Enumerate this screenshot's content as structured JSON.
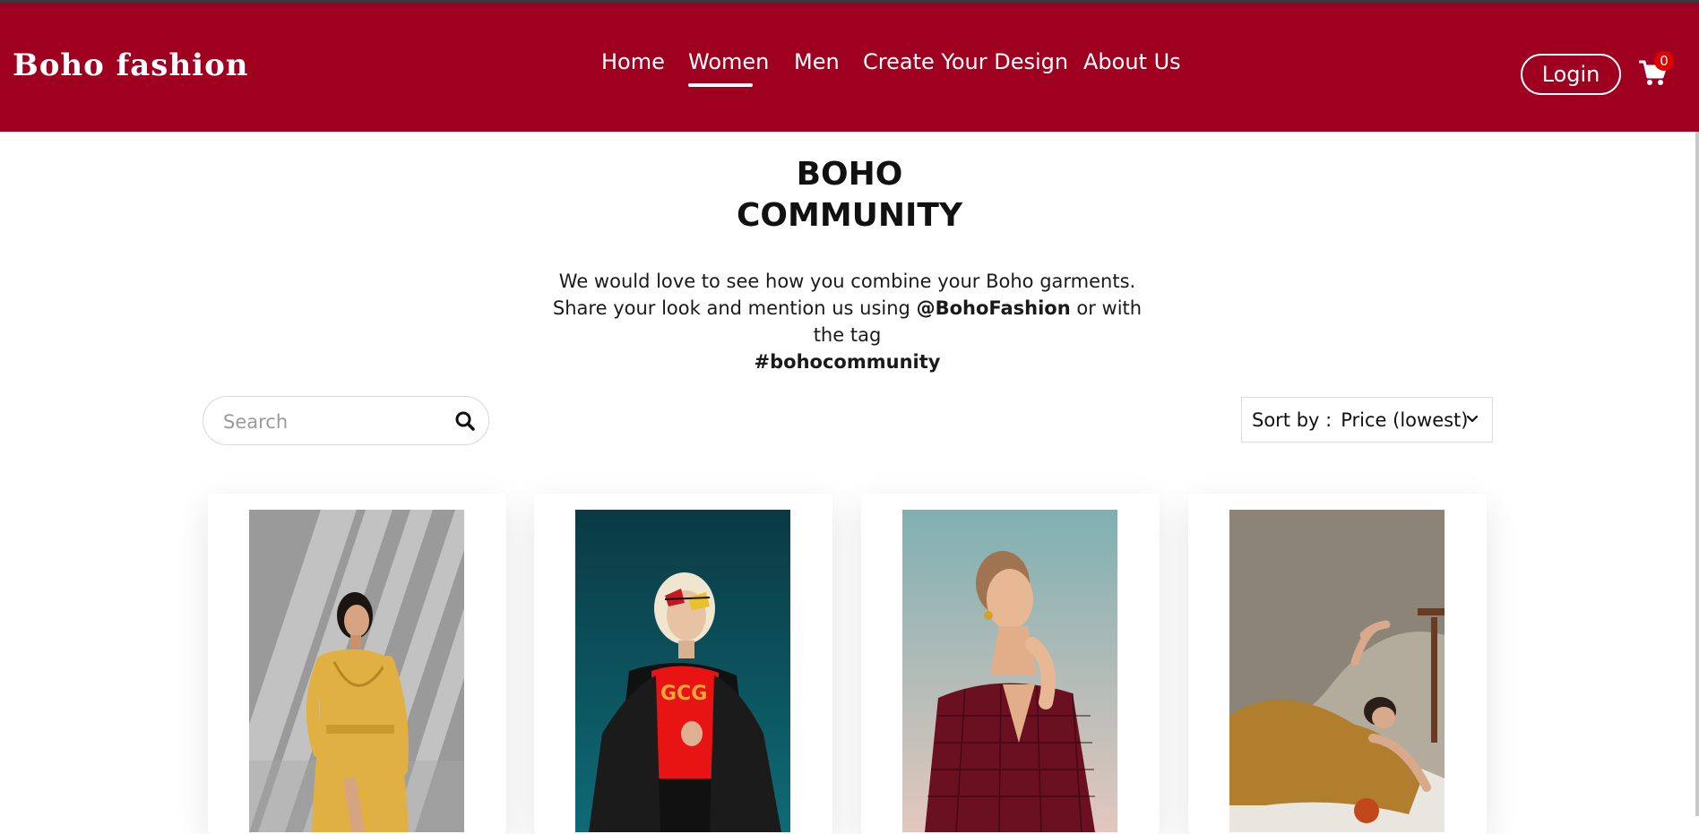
{
  "brand": {
    "logo_text": "Boho fashion",
    "accent_color": "#a00020"
  },
  "nav": {
    "items": [
      {
        "label": "Home",
        "active": false
      },
      {
        "label": "Women",
        "active": true
      },
      {
        "label": "Men",
        "active": false
      },
      {
        "label": "Create Your Design",
        "active": false
      },
      {
        "label": "About Us",
        "active": false
      }
    ],
    "login_label": "Login",
    "cart_count": "0"
  },
  "community": {
    "title_line1": "BOHO",
    "title_line2": "COMMUNITY",
    "desc_part1": "We would love to see how you combine your Boho garments. Share your look and mention us using ",
    "handle": "@BohoFashion",
    "desc_part2": " or with the tag ",
    "hashtag": "#bohocommunity"
  },
  "search": {
    "placeholder": "Search",
    "value": "",
    "icon": "search-icon"
  },
  "sort": {
    "label": "Sort by :",
    "value": "Price (lowest)",
    "icon": "chevron-down-icon"
  },
  "products": [
    {
      "image": "model-yellow-wrap-dress"
    },
    {
      "image": "model-red-tshirt-sunglasses"
    },
    {
      "image": "model-burgundy-blouse"
    },
    {
      "image": "model-mustard-jumpsuit-reclining"
    }
  ]
}
